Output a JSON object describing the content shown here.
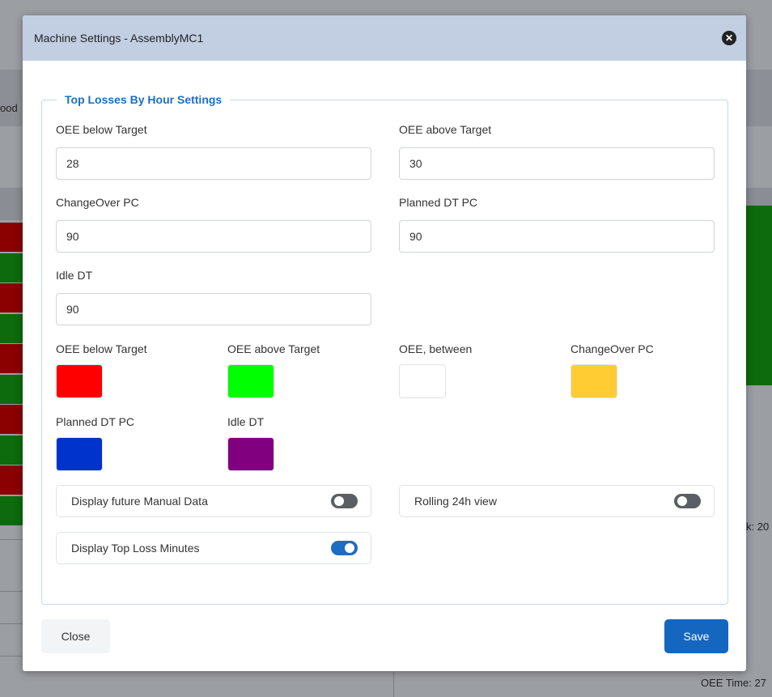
{
  "background": {
    "left_header_fragment": "ood",
    "right_text_1": "k: 20",
    "right_text_2": "OEE Time: 27",
    "left_status_colors": [
      "#8b0000",
      "#0d6b0d",
      "#8b0000",
      "#0d6b0d",
      "#8b0000",
      "#0d6b0d",
      "#8b0000",
      "#0d6b0d",
      "#8b0000",
      "#0d6b0d"
    ]
  },
  "modal": {
    "title": "Machine Settings - AssemblyMC1",
    "close_icon": "close-circle-icon",
    "section_title": "Top Losses By Hour Settings",
    "fields": {
      "oee_below_target": {
        "label": "OEE below Target",
        "value": "28"
      },
      "oee_above_target": {
        "label": "OEE above Target",
        "value": "30"
      },
      "changeover_pc": {
        "label": "ChangeOver PC",
        "value": "90"
      },
      "planned_dt_pc": {
        "label": "Planned DT PC",
        "value": "90"
      },
      "idle_dt": {
        "label": "Idle DT",
        "value": "90"
      }
    },
    "colors": {
      "oee_below_target": {
        "label": "OEE below Target",
        "color": "#ff0000"
      },
      "oee_above_target": {
        "label": "OEE above Target",
        "color": "#00ff00"
      },
      "oee_between": {
        "label": "OEE, between",
        "color": "#ffffff"
      },
      "changeover_pc": {
        "label": "ChangeOver PC",
        "color": "#ffcc33"
      },
      "planned_dt_pc": {
        "label": "Planned DT PC",
        "color": "#0033cc"
      },
      "idle_dt": {
        "label": "Idle DT",
        "color": "#800080"
      }
    },
    "toggles": {
      "display_future_manual_data": {
        "label": "Display future Manual Data",
        "on": false
      },
      "rolling_24h_view": {
        "label": "Rolling 24h view",
        "on": false
      },
      "display_top_loss_minutes": {
        "label": "Display Top Loss Minutes",
        "on": true
      }
    },
    "buttons": {
      "close": "Close",
      "save": "Save"
    },
    "accent_color": "#1b6ec2"
  }
}
